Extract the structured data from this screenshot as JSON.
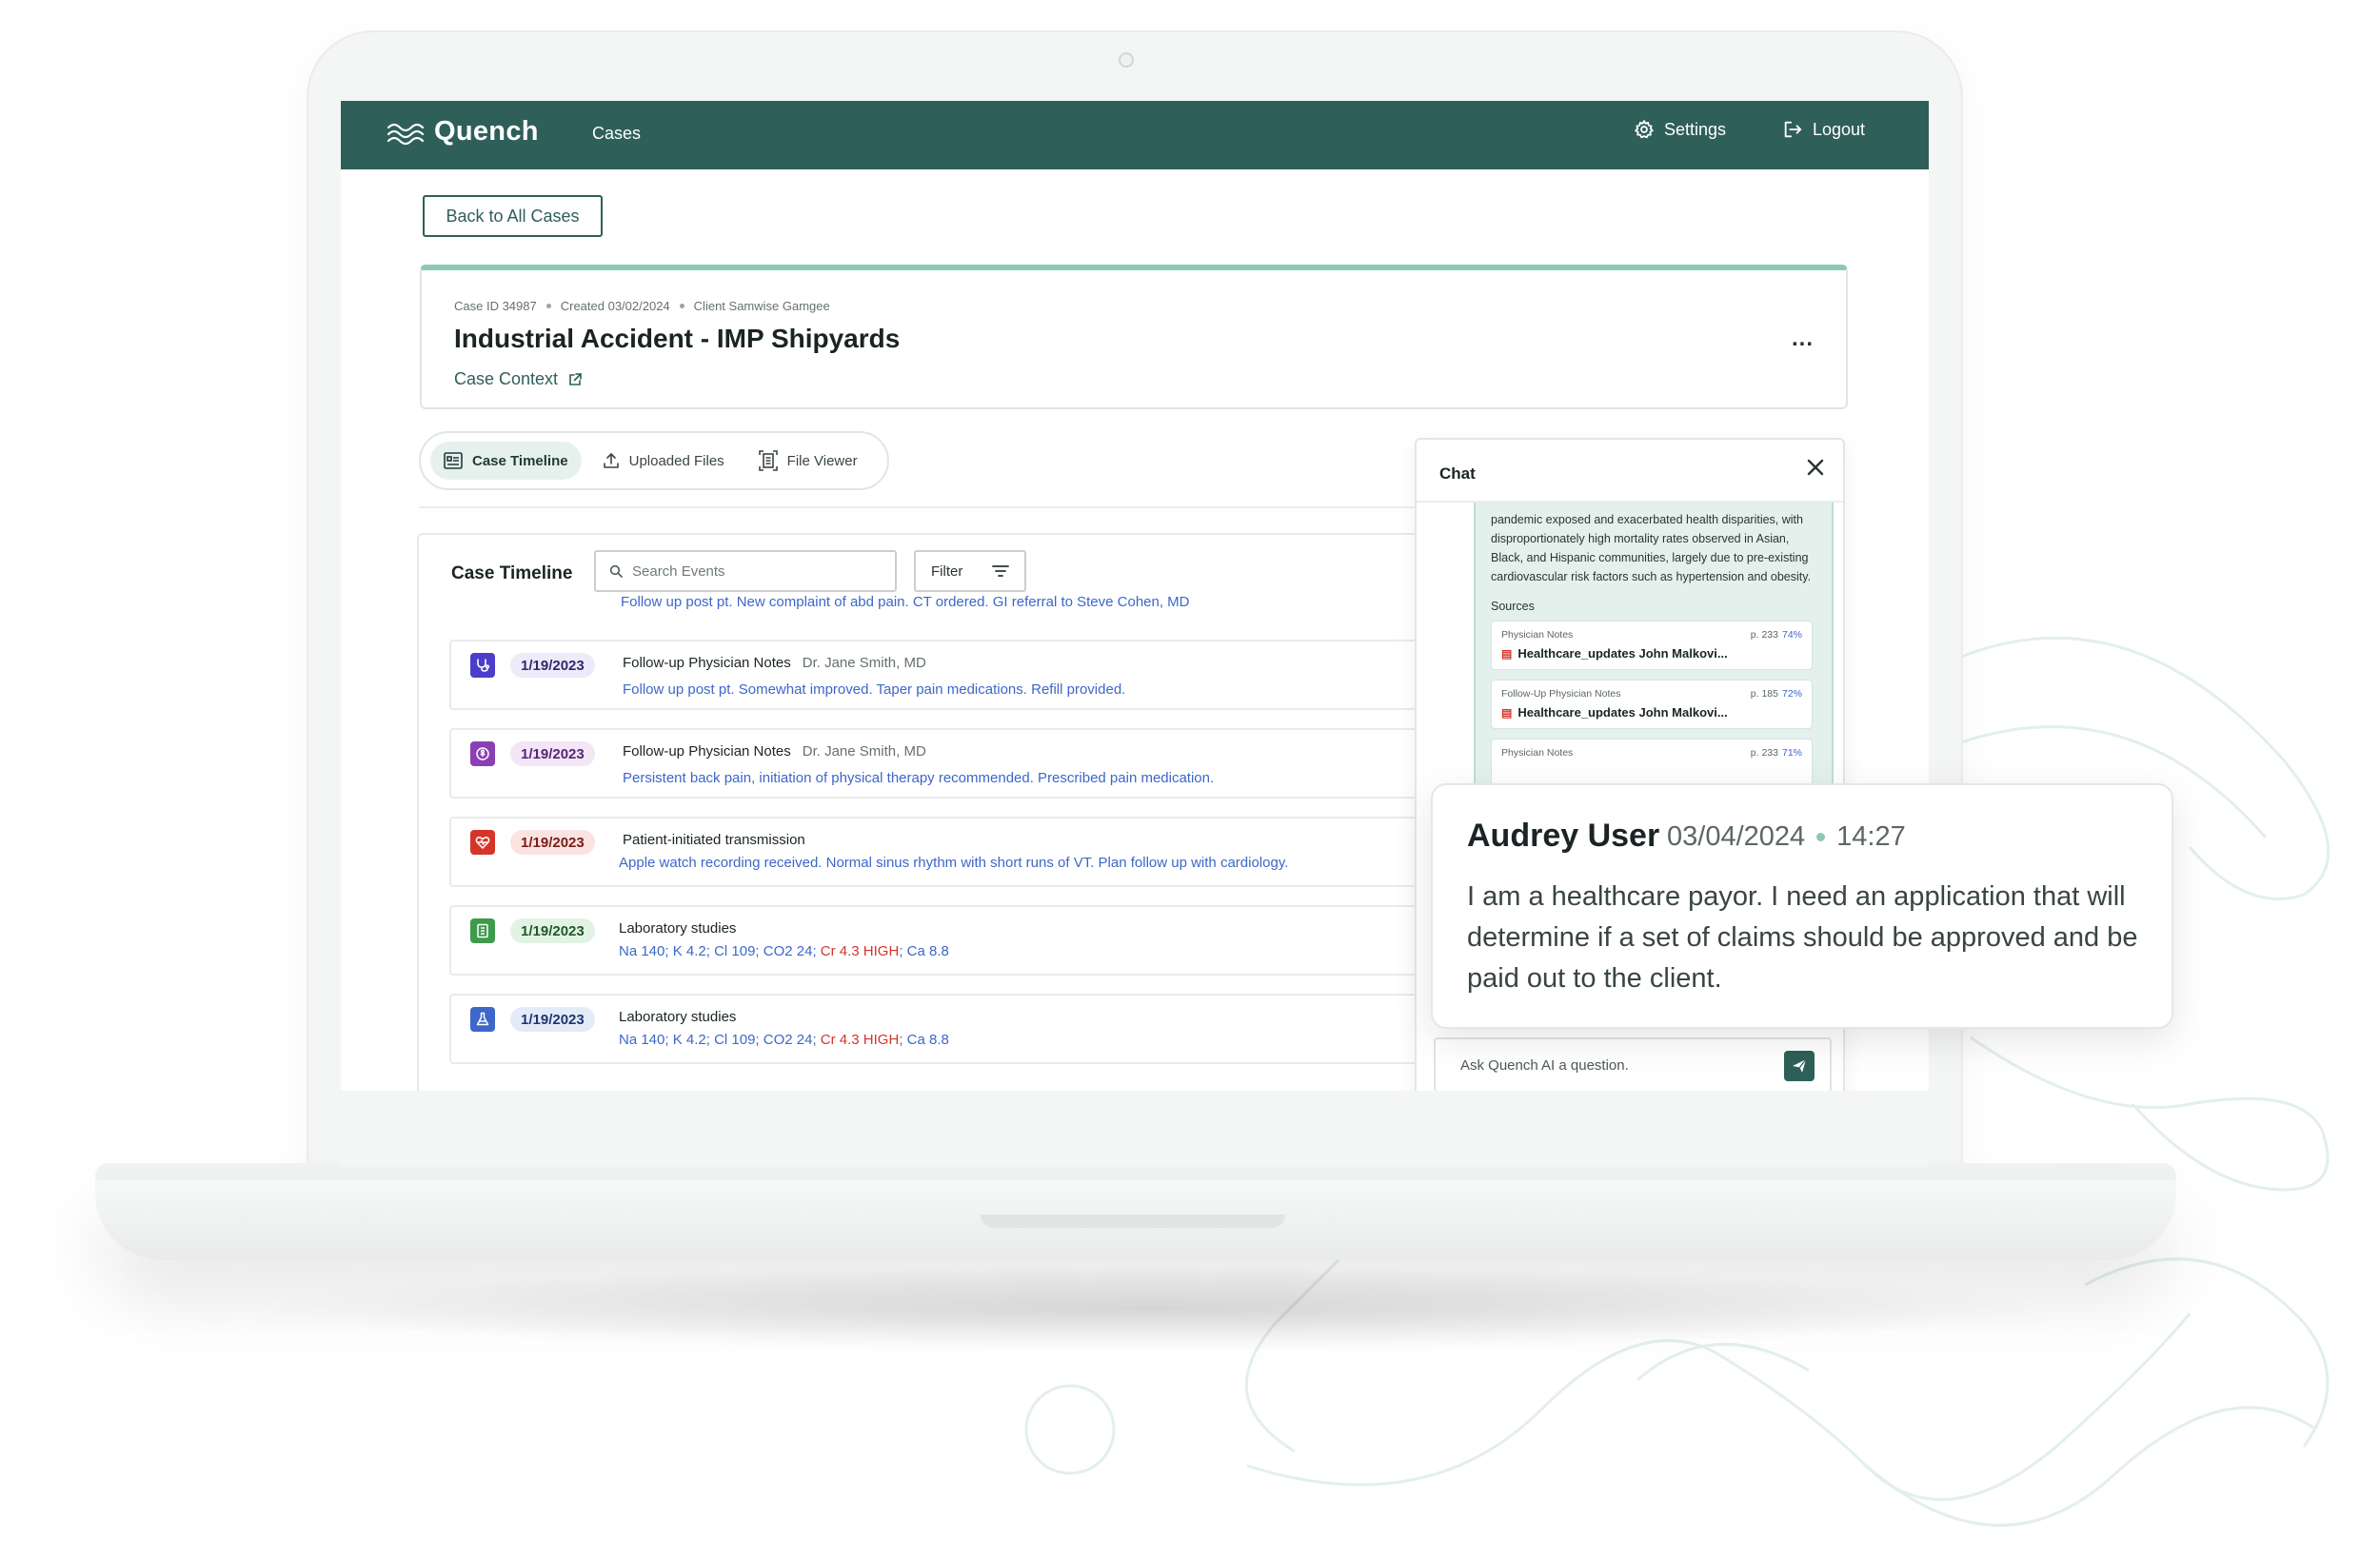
{
  "nav": {
    "brand": "Quench",
    "cases": "Cases",
    "settings": "Settings",
    "logout": "Logout"
  },
  "back_button": "Back to All Cases",
  "case": {
    "id": "Case ID 34987",
    "created": "Created 03/02/2024",
    "client": "Client Samwise Gamgee",
    "title": "Industrial Accident - IMP Shipyards",
    "context_link": "Case Context",
    "more": "..."
  },
  "tabs": [
    {
      "label": "Case Timeline",
      "icon": "timeline-icon",
      "active": true
    },
    {
      "label": "Uploaded Files",
      "icon": "upload-icon",
      "active": false
    },
    {
      "label": "File Viewer",
      "icon": "file-viewer-icon",
      "active": false
    }
  ],
  "timeline": {
    "title": "Case Timeline",
    "search_placeholder": "Search Events",
    "filter_label": "Filter",
    "partial_row_text": "Follow up post pt. New complaint of abd pain. CT ordered. GI referral to Steve Cohen, MD",
    "events": [
      {
        "date": "1/19/2023",
        "heading": "Follow-up Physician Notes",
        "author": "Dr. Jane Smith, MD",
        "desc": "Follow up post pt. Somewhat improved. Taper pain medications. Refill provided.",
        "icon": "stethoscope-icon",
        "icon_color": "#4b3fc9",
        "badge_bg": "#eeeaf9",
        "badge_color": "#2d2a6e"
      },
      {
        "date": "1/19/2023",
        "heading": "Follow-up Physician Notes",
        "author": "Dr. Jane Smith, MD",
        "desc": "Persistent back pain, initiation of physical therapy recommended. Prescribed pain medication.",
        "icon": "body-icon",
        "icon_color": "#8a3fb5",
        "badge_bg": "#f3e6f7",
        "badge_color": "#5a2477"
      },
      {
        "date": "1/19/2023",
        "heading": "Patient-initiated transmission",
        "author": "",
        "desc": "Apple watch recording received. Normal sinus rhythm with short runs of VT. Plan follow up with cardiology.",
        "icon": "heart-icon",
        "icon_color": "#d6342a",
        "badge_bg": "#fbe3e1",
        "badge_color": "#7a1d17"
      },
      {
        "date": "1/19/2023",
        "heading": "Laboratory studies",
        "author": "",
        "desc_parts": [
          "Na 140; K 4.2; Cl 109; CO2 24; ",
          "Cr 4.3 HIGH",
          "; Ca 8.8"
        ],
        "icon": "lab-report-icon",
        "icon_color": "#3f9a4c",
        "badge_bg": "#e2f3e4",
        "badge_color": "#1e5a28"
      },
      {
        "date": "1/19/2023",
        "heading": "Laboratory studies",
        "author": "",
        "desc_parts": [
          "Na 140; K 4.2; Cl 109; CO2 24; ",
          "Cr 4.3 HIGH",
          "; Ca 8.8"
        ],
        "icon": "flask-icon",
        "icon_color": "#3d67c9",
        "badge_bg": "#e3ebf9",
        "badge_color": "#1e3670"
      }
    ]
  },
  "chat": {
    "title": "Chat",
    "message": "pandemic exposed and exacerbated health disparities, with disproportionately high mortality rates observed in Asian, Black, and Hispanic communities, largely due to pre-existing cardiovascular risk factors such as hypertension and obesity.",
    "sources_label": "Sources",
    "sources": [
      {
        "type": "Physician Notes",
        "page": "p. 233",
        "pct": "74%",
        "file": "Healthcare_updates John Malkovi..."
      },
      {
        "type": "Follow-Up Physician Notes",
        "page": "p. 185",
        "pct": "72%",
        "file": "Healthcare_updates John Malkovi..."
      },
      {
        "type": "Physician Notes",
        "page": "p. 233",
        "pct": "71%",
        "file": ""
      }
    ],
    "input_placeholder": "Ask Quench AI a question."
  },
  "quote": {
    "user": "Audrey User",
    "date": "03/04/2024",
    "time": "14:27",
    "text": "I am a healthcare payor. I need an application that will determine if a set of claims should be approved and be paid out to the client."
  },
  "colors": {
    "brand": "#2f5f59",
    "accent": "#8cc9b5",
    "link": "#3d67c9",
    "danger": "#d6342a"
  }
}
